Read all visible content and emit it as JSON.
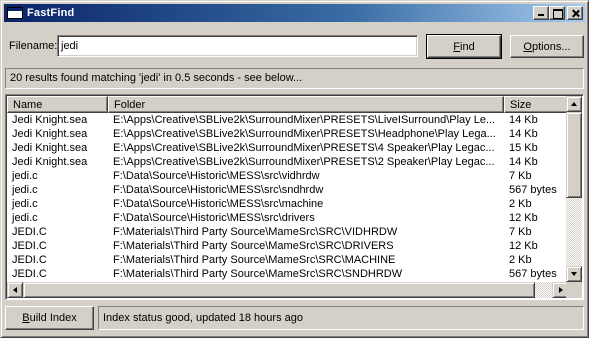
{
  "window": {
    "title": "FastFind",
    "controls": {
      "minimize": "minimize",
      "maximize": "maximize",
      "close": "close"
    }
  },
  "search": {
    "label": "Filename:",
    "value": "jedi",
    "find_label": "Find",
    "find_accel_index": 0,
    "options_label": "Options...",
    "options_accel_index": 0
  },
  "results_status": "20 results found matching 'jedi' in 0.5 seconds - see below...",
  "table": {
    "headers": {
      "name": "Name",
      "folder": "Folder",
      "size": "Size"
    },
    "rows": [
      {
        "name": "Jedi Knight.sea",
        "folder": "E:\\Apps\\Creative\\SBLive2k\\SurroundMixer\\PRESETS\\LiveISurround\\Play Le...",
        "size": "14 Kb"
      },
      {
        "name": "Jedi Knight.sea",
        "folder": "E:\\Apps\\Creative\\SBLive2k\\SurroundMixer\\PRESETS\\Headphone\\Play Lega...",
        "size": "14 Kb"
      },
      {
        "name": "Jedi Knight.sea",
        "folder": "E:\\Apps\\Creative\\SBLive2k\\SurroundMixer\\PRESETS\\4 Speaker\\Play Legac...",
        "size": "15 Kb"
      },
      {
        "name": "Jedi Knight.sea",
        "folder": "E:\\Apps\\Creative\\SBLive2k\\SurroundMixer\\PRESETS\\2 Speaker\\Play Legac...",
        "size": "14 Kb"
      },
      {
        "name": "jedi.c",
        "folder": "F:\\Data\\Source\\Historic\\MESS\\src\\vidhrdw",
        "size": "7 Kb"
      },
      {
        "name": "jedi.c",
        "folder": "F:\\Data\\Source\\Historic\\MESS\\src\\sndhrdw",
        "size": "567 bytes"
      },
      {
        "name": "jedi.c",
        "folder": "F:\\Data\\Source\\Historic\\MESS\\src\\machine",
        "size": "2 Kb"
      },
      {
        "name": "jedi.c",
        "folder": "F:\\Data\\Source\\Historic\\MESS\\src\\drivers",
        "size": "12 Kb"
      },
      {
        "name": "JEDI.C",
        "folder": "F:\\Materials\\Third Party Source\\MameSrc\\SRC\\VIDHRDW",
        "size": "7 Kb"
      },
      {
        "name": "JEDI.C",
        "folder": "F:\\Materials\\Third Party Source\\MameSrc\\SRC\\DRIVERS",
        "size": "12 Kb"
      },
      {
        "name": "JEDI.C",
        "folder": "F:\\Materials\\Third Party Source\\MameSrc\\SRC\\MACHINE",
        "size": "2 Kb"
      },
      {
        "name": "JEDI.C",
        "folder": "F:\\Materials\\Third Party Source\\MameSrc\\SRC\\SNDHRDW",
        "size": "567 bytes"
      }
    ]
  },
  "footer": {
    "build_label": "Build Index",
    "build_accel_index": 0,
    "index_status": "Index status good, updated 18 hours ago"
  },
  "colors": {
    "titlebar_start": "#0a246a",
    "titlebar_end": "#a6caf0",
    "face": "#d4d0c8"
  }
}
